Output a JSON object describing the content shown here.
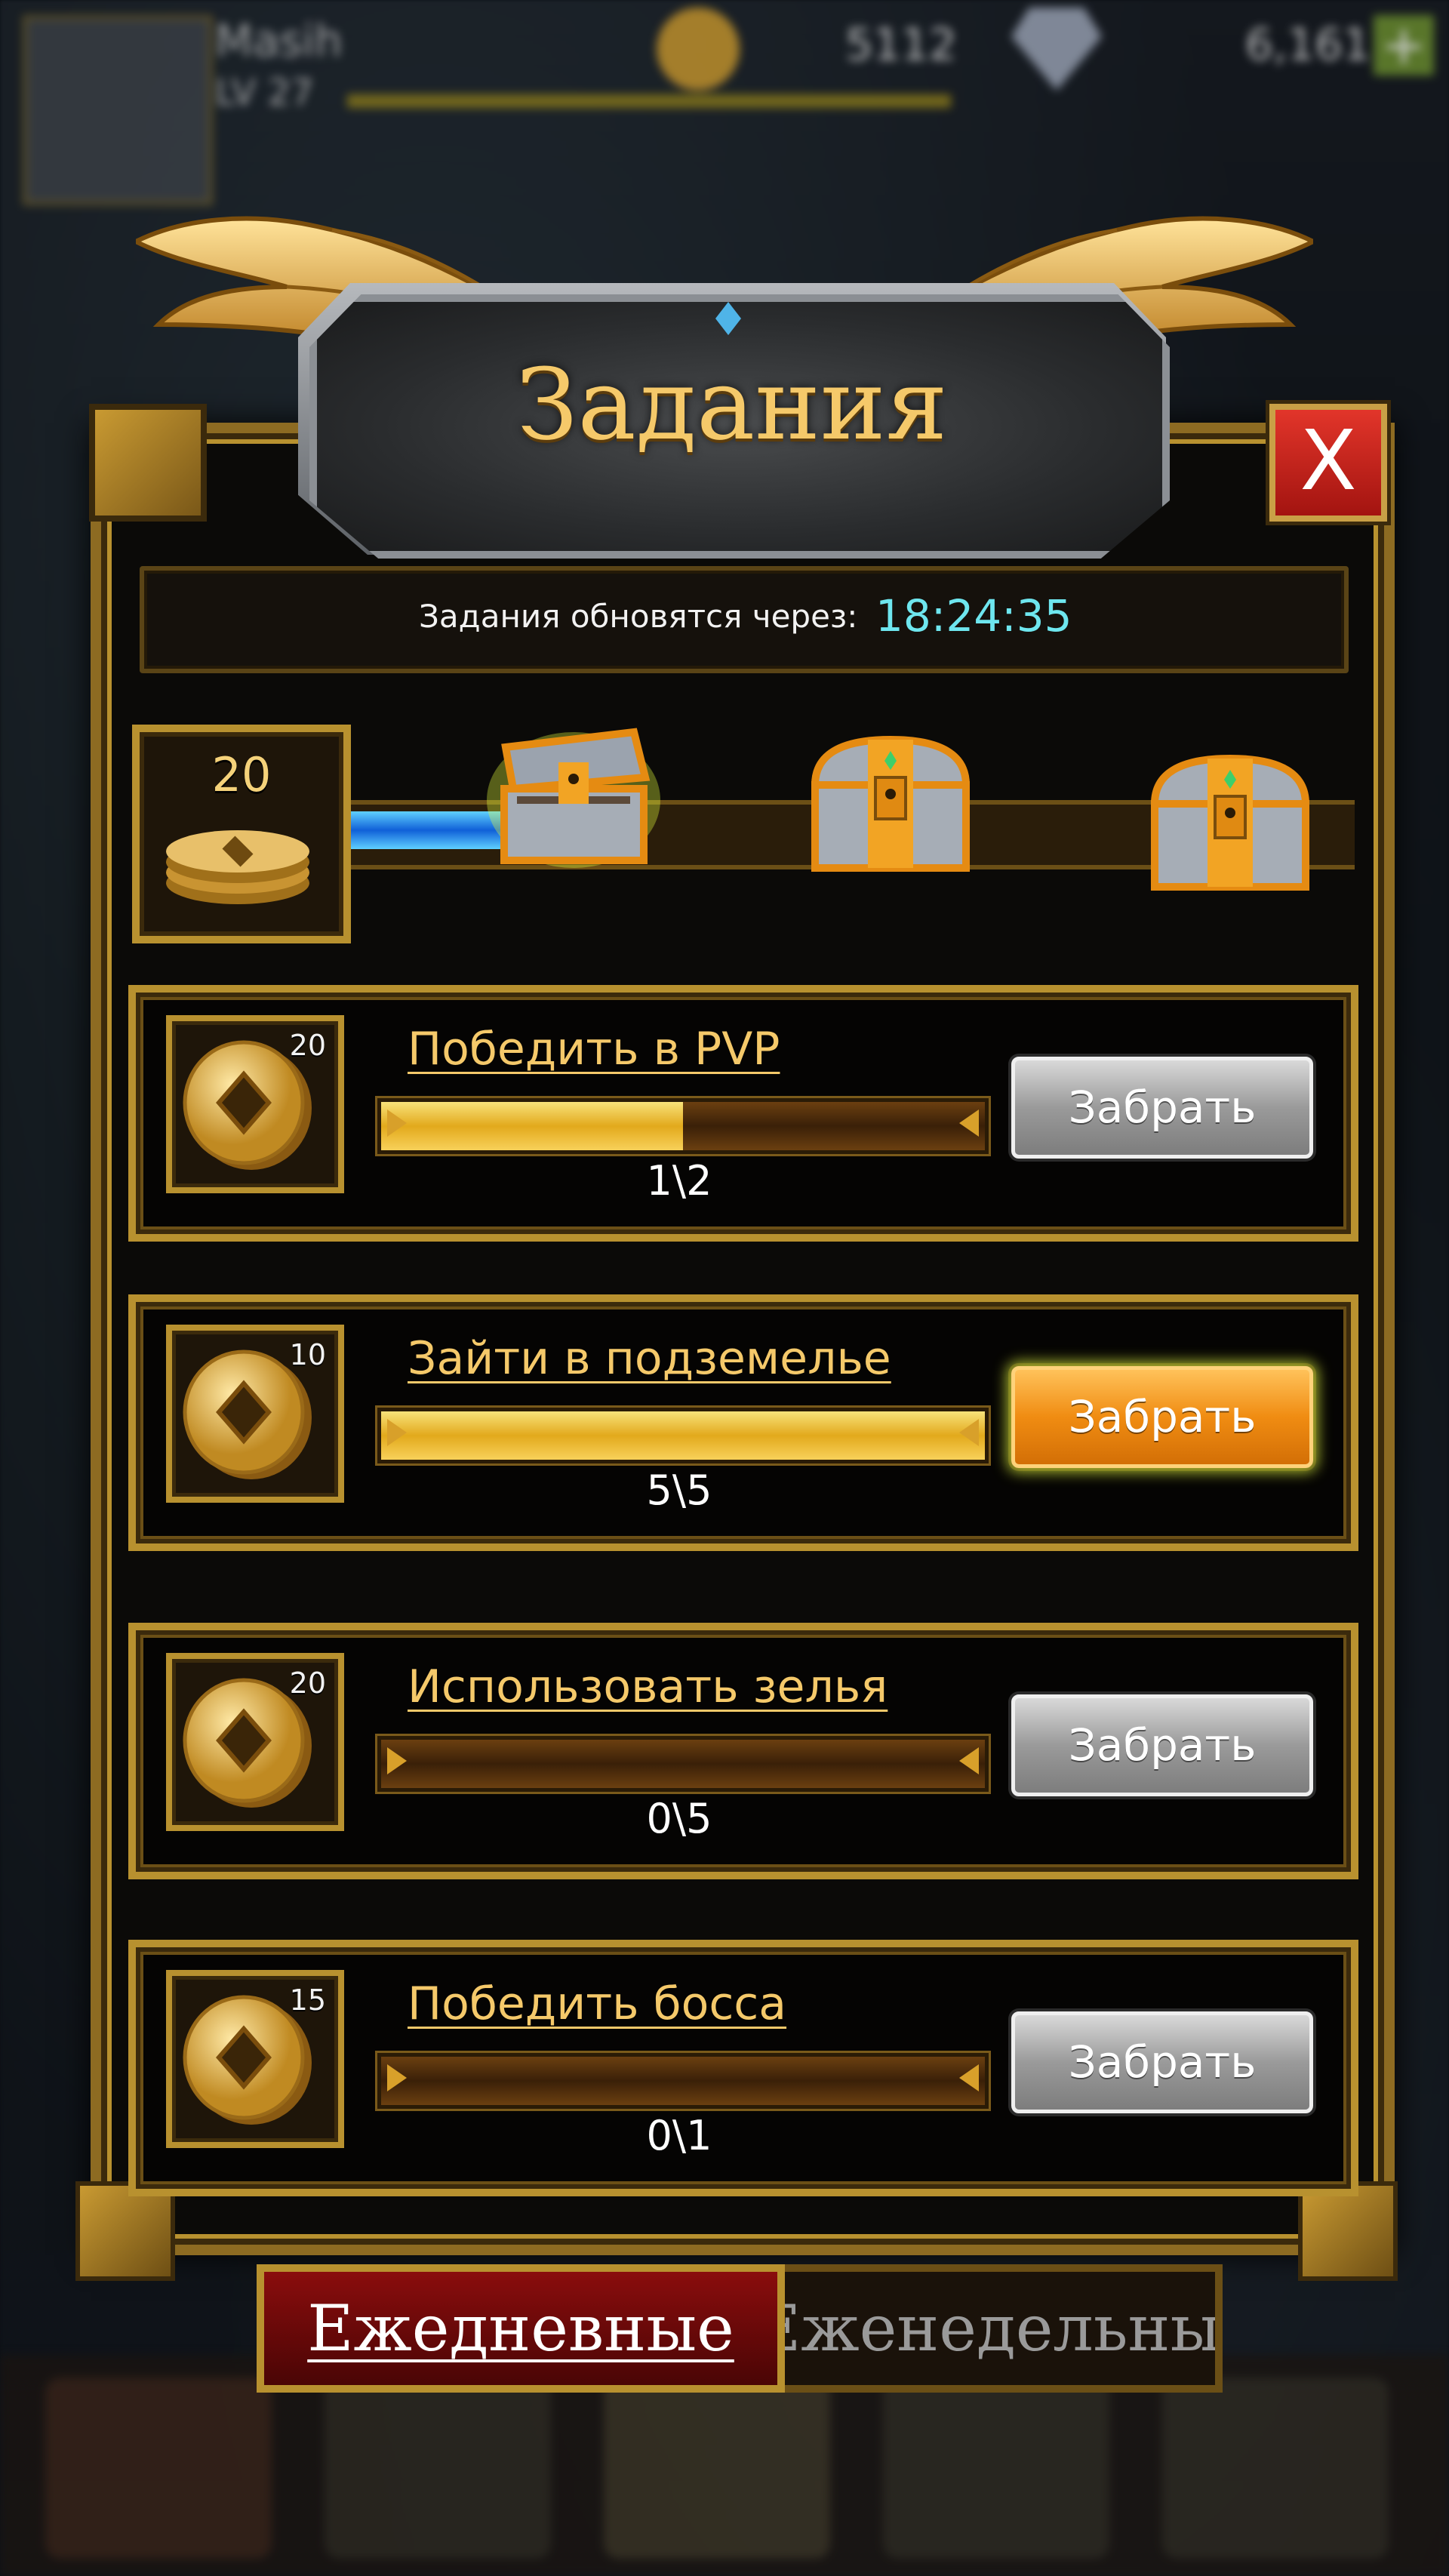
{
  "hud": {
    "player_name": "Masih",
    "level": "LV 27",
    "gold": "5112",
    "gems": "6,161"
  },
  "panel": {
    "title": "Задания",
    "close_label": "X"
  },
  "timer": {
    "label": "Задания обновятся через:",
    "value": "18:24:35"
  },
  "chest_progress": {
    "points": "20",
    "fill_fraction": 0.19,
    "chests": [
      {
        "state": "open"
      },
      {
        "state": "closed"
      },
      {
        "state": "closed"
      }
    ]
  },
  "quests": [
    {
      "title": "Победить в PVP",
      "reward": "20",
      "current": 1,
      "target": 2,
      "progress_text": "1\\2",
      "button": "Забрать",
      "claimable": false
    },
    {
      "title": "Зайти в подземелье",
      "reward": "10",
      "current": 5,
      "target": 5,
      "progress_text": "5\\5",
      "button": "Забрать",
      "claimable": true
    },
    {
      "title": "Использовать зелья",
      "reward": "20",
      "current": 0,
      "target": 5,
      "progress_text": "0\\5",
      "button": "Забрать",
      "claimable": false
    },
    {
      "title": "Победить босса",
      "reward": "15",
      "current": 0,
      "target": 1,
      "progress_text": "0\\1",
      "button": "Забрать",
      "claimable": false
    }
  ],
  "tabs": {
    "daily": "Ежедневные",
    "weekly": "Еженедельные"
  },
  "colors": {
    "gold_text": "#f5c96a",
    "timer": "#6ee6ef",
    "frame": "#b8912f",
    "claim_active": "#f08c12",
    "claim_inactive": "#9a9a9a"
  },
  "icons": [
    "coin-icon",
    "chest-icon",
    "close-icon",
    "wing-icon"
  ]
}
